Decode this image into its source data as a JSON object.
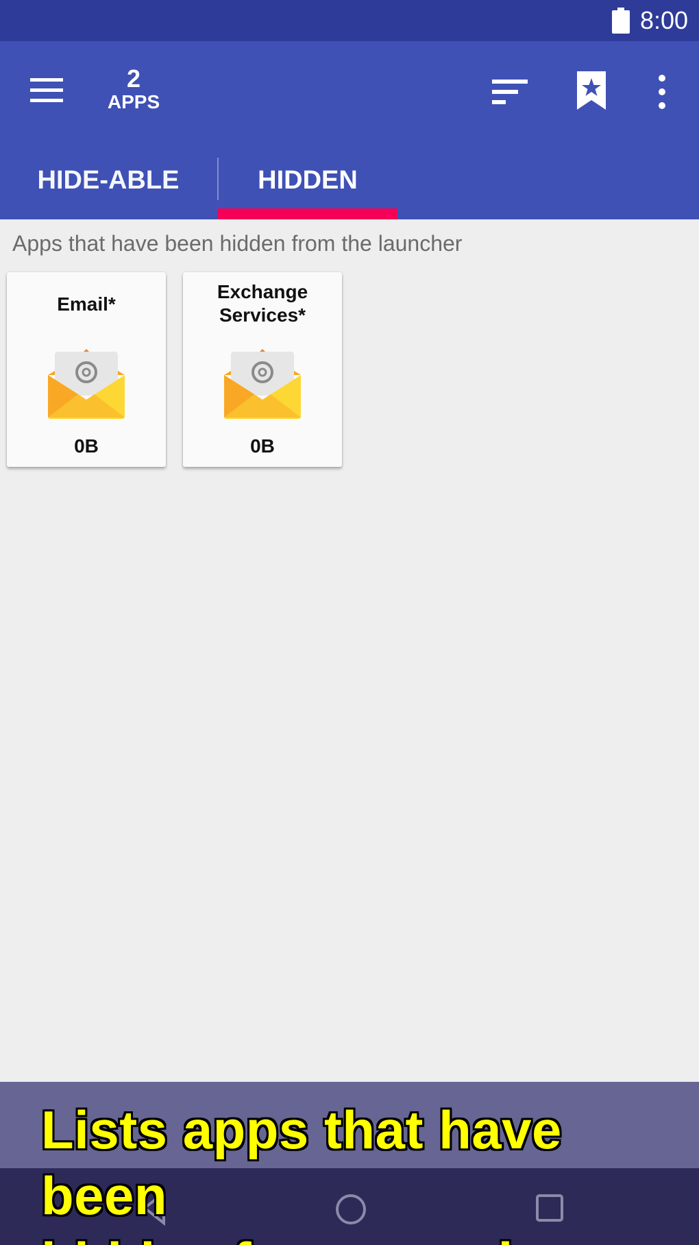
{
  "status_bar": {
    "time": "8:00",
    "battery_icon": "battery-full-icon"
  },
  "app_bar": {
    "menu_icon": "menu-icon",
    "count": "2",
    "count_label": "APPS",
    "sort_icon": "sort-icon",
    "bookmark_icon": "bookmark-star-icon",
    "more_icon": "more-vert-icon"
  },
  "tabs": [
    {
      "label": "HIDE-ABLE",
      "selected": false
    },
    {
      "label": "HIDDEN",
      "selected": true
    }
  ],
  "colors": {
    "status_bar": "#2e3b99",
    "app_bar": "#3f51b5",
    "tab_indicator": "#f50057",
    "background": "#eeeeee",
    "caption_text": "#ffff00"
  },
  "main": {
    "description": "Apps that have been hidden from the launcher",
    "apps": [
      {
        "name": "Email*",
        "size": "0B",
        "icon": "email-envelope-icon"
      },
      {
        "name": "Exchange\nServices*",
        "size": "0B",
        "icon": "email-envelope-icon"
      }
    ]
  },
  "caption": "Lists apps that have been\nhidden from app drawer",
  "nav_bar": {
    "back_icon": "back-icon",
    "home_icon": "home-icon",
    "recents_icon": "recents-icon"
  }
}
